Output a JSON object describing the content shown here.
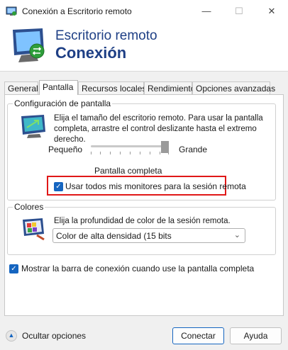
{
  "window": {
    "title": "Conexión a Escritorio remoto",
    "controls": {
      "minimize": "—",
      "maximize": "☐",
      "close": "✕"
    }
  },
  "banner": {
    "line1": "Escritorio remoto",
    "line2": "Conexión",
    "title_color": "#1e3f85"
  },
  "tabs": [
    {
      "label": "General",
      "active": false
    },
    {
      "label": "Pantalla",
      "active": true
    },
    {
      "label": "Recursos locales",
      "active": false
    },
    {
      "label": "Rendimiento",
      "active": false
    },
    {
      "label": "Opciones avanzadas",
      "active": false
    }
  ],
  "display_config": {
    "legend": "Configuración de pantalla",
    "description_line1": "Elija el tamaño del escritorio remoto. Para usar la pantalla",
    "description_line2": "completa, arrastre el control deslizante hasta el extremo derecho.",
    "slider_min_label": "Pequeño",
    "slider_max_label": "Grande",
    "slider_value_label": "Pantalla completa",
    "slider_position": 1.0,
    "use_all_monitors_label": "Usar todos mis monitores para la sesión remota",
    "use_all_monitors_checked": true
  },
  "colors": {
    "legend": "Colores",
    "description": "Elija la profundidad de color de la sesión remota.",
    "selected_option": "Color de alta densidad (15 bits"
  },
  "connection_bar": {
    "label": "Mostrar la barra de conexión cuando use la pantalla completa",
    "checked": true
  },
  "footer": {
    "hide_options_label": "Ocultar opciones",
    "connect_label": "Conectar",
    "help_label": "Ayuda"
  },
  "accent_color": "#1565c0",
  "highlight_color": "#e01818"
}
